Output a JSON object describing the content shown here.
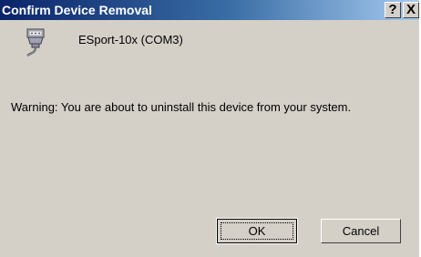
{
  "window": {
    "title": "Confirm Device Removal",
    "help_glyph": "?",
    "close_glyph": "X"
  },
  "device": {
    "name": "ESport-10x (COM3)",
    "icon": "serial-port-connector-icon"
  },
  "message": {
    "warning": "Warning: You are about to uninstall this device from your system."
  },
  "buttons": {
    "ok_label": "OK",
    "cancel_label": "Cancel"
  },
  "colors": {
    "titlebar_start": "#0a246a",
    "titlebar_end": "#a6caf0",
    "face": "#d4d0c8"
  }
}
